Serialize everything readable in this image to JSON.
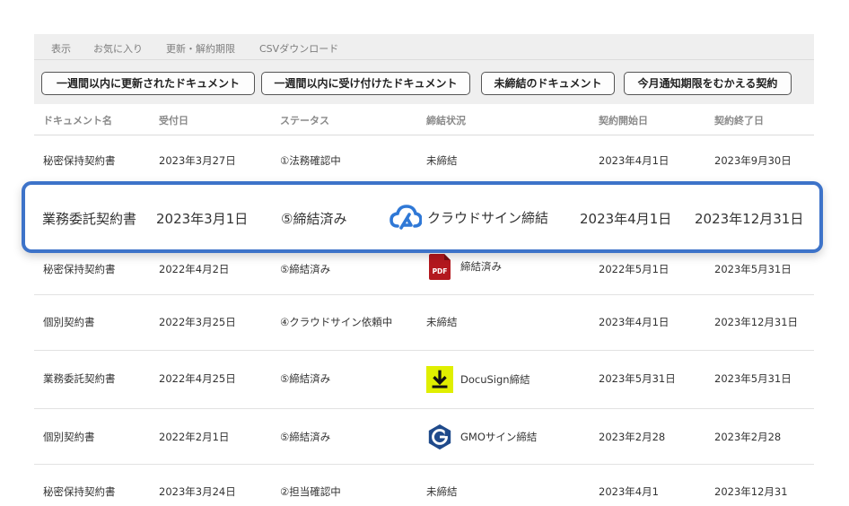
{
  "menu": [
    "表示",
    "お気に入り",
    "更新・解約期限",
    "CSVダウンロード"
  ],
  "filters": [
    "一週間以内に更新されたドキュメント",
    "一週間以内に受け付けたドキュメント",
    "未締結のドキュメント",
    "今月通知期限をむかえる契約"
  ],
  "columns": [
    "ドキュメント名",
    "受付日",
    "ステータス",
    "締結状況",
    "契約開始日",
    "契約終了日"
  ],
  "icons": {
    "cloudsign": "cloudsign-icon",
    "pdf": "pdf-icon",
    "docusign": "docusign-icon",
    "gmo": "gmo-sign-icon"
  },
  "colors": {
    "highlight_border": "#3d73c9",
    "pdf_red": "#b3181e",
    "docusign_yellow": "#e0ef00",
    "gmo_blue": "#1f4a8b"
  },
  "pdf_icon_text": "PDF",
  "rows": [
    {
      "name": "秘密保持契約書",
      "received": "2023年3月27日",
      "status": "①法務確認中",
      "sign": "未締結",
      "start": "2023年4月1日",
      "end": "2023年9月30日"
    },
    {
      "name": "業務委託契約書",
      "received": "2023年3月1日",
      "status": "⑤締結済み",
      "sign": "クラウドサイン締結",
      "start": "2023年4月1日",
      "end": "2023年12月31日"
    },
    {
      "name": "秘密保持契約書",
      "received": "2022年4月2日",
      "status": "⑤締結済み",
      "sign": "締結済み",
      "start": "2022年5月1日",
      "end": "2023年5月31日"
    },
    {
      "name": "個別契約書",
      "received": "2022年3月25日",
      "status": "④クラウドサイン依頼中",
      "sign": "未締結",
      "start": "2023年4月1日",
      "end": "2023年12月31日"
    },
    {
      "name": "業務委託契約書",
      "received": "2022年4月25日",
      "status": "⑤締結済み",
      "sign": "DocuSign締結",
      "start": "2023年5月31日",
      "end": "2023年5月31日"
    },
    {
      "name": "個別契約書",
      "received": "2022年2月1日",
      "status": "⑤締結済み",
      "sign": "GMOサイン締結",
      "start": "2023年2月28",
      "end": "2023年2月28"
    },
    {
      "name": "秘密保持契約書",
      "received": "2023年3月24日",
      "status": "②担当確認中",
      "sign": "未締結",
      "start": "2023年4月1",
      "end": "2023年12月31"
    }
  ]
}
